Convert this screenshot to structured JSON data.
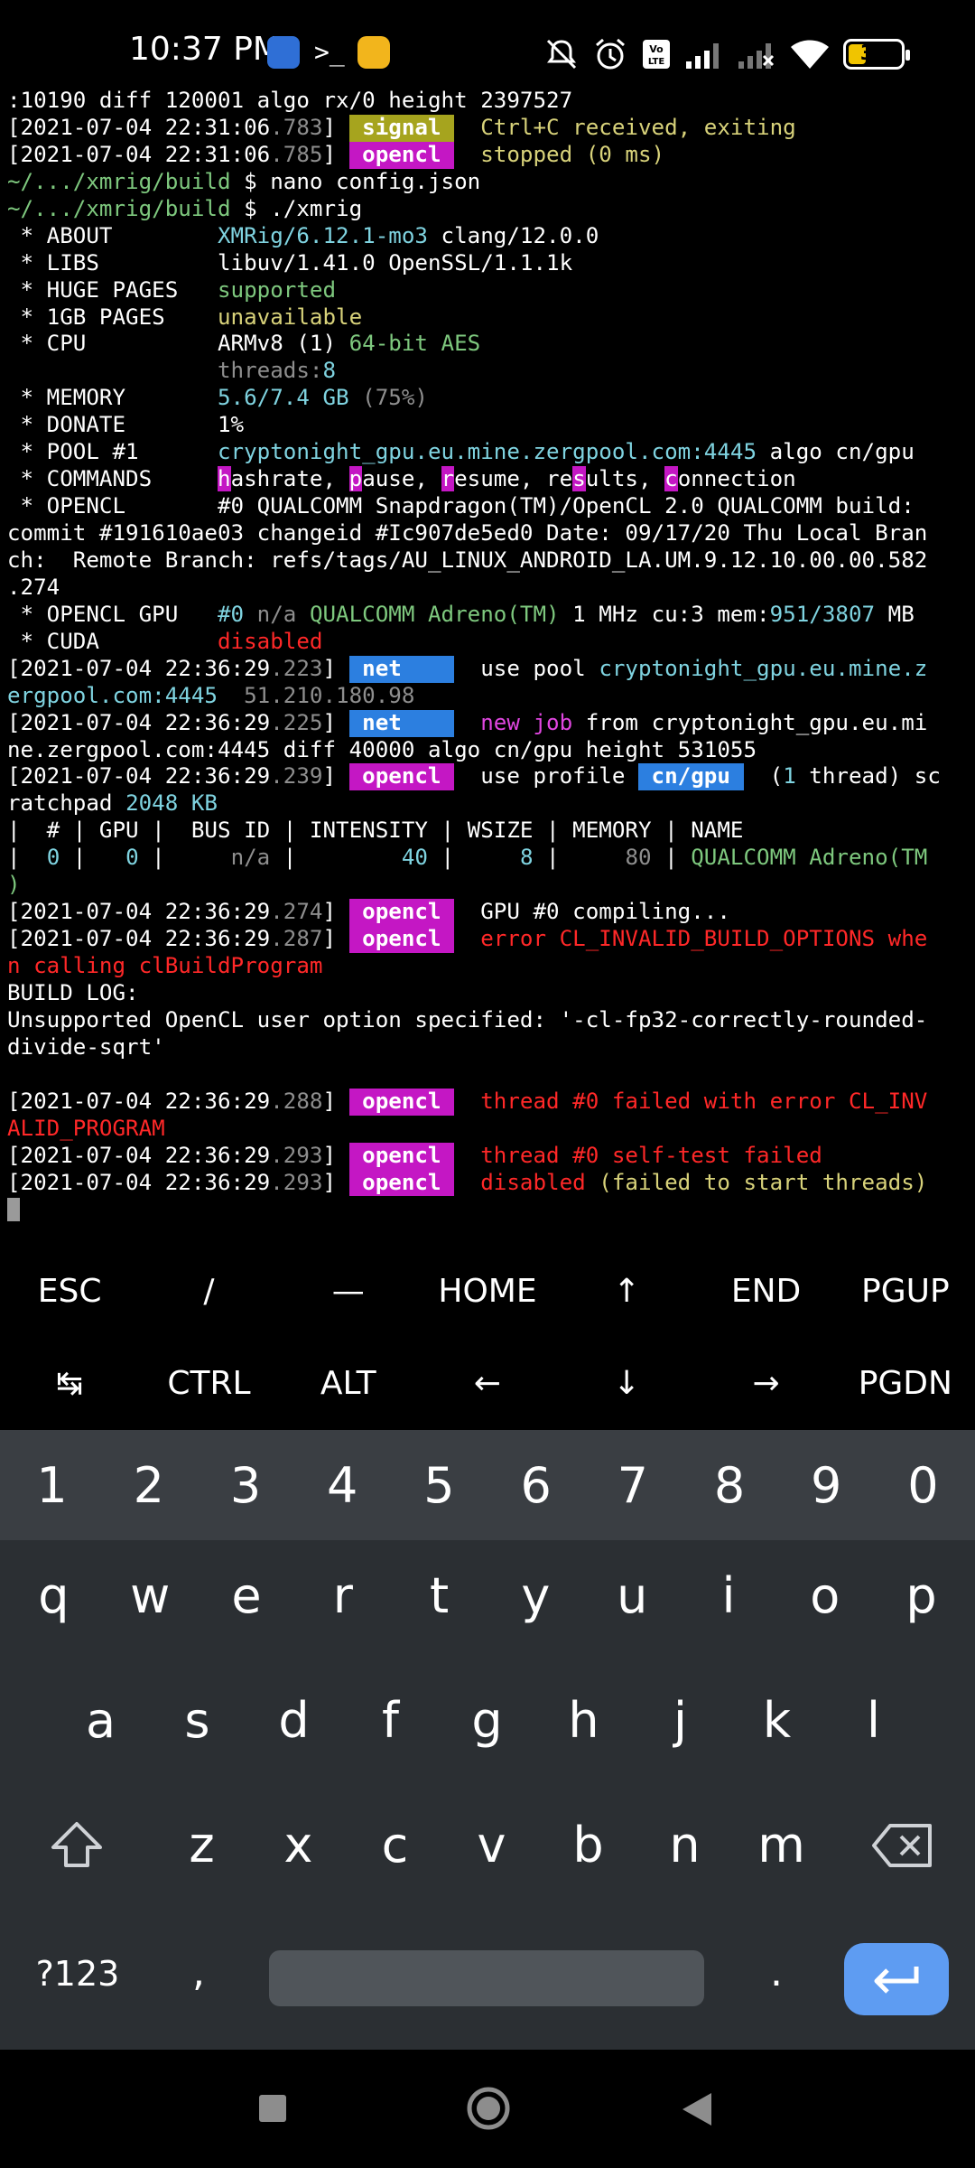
{
  "status_bar": {
    "time": "10:37 PM",
    "battery": "31",
    "icons": [
      "mute-icon",
      "alarm-icon",
      "volte-icon",
      "signal-icon",
      "signal-off-icon",
      "wifi-icon",
      "battery-icon"
    ]
  },
  "terminal": {
    "lines": [
      [
        {
          "t": ":10190 diff 120001 algo rx/0 height 2397527",
          "c": "w"
        }
      ],
      [
        {
          "t": "[2021-07-04 22:31:06",
          "c": "w"
        },
        {
          "t": ".783",
          "c": "gr"
        },
        {
          "t": "] ",
          "c": "w"
        },
        {
          "t": " signal ",
          "c": "tag tag-signal"
        },
        {
          "t": "  ",
          "c": "w"
        },
        {
          "t": "Ctrl+C received, exiting",
          "c": "y"
        }
      ],
      [
        {
          "t": "[2021-07-04 22:31:06",
          "c": "w"
        },
        {
          "t": ".785",
          "c": "gr"
        },
        {
          "t": "] ",
          "c": "w"
        },
        {
          "t": " opencl ",
          "c": "tag tag-opencl"
        },
        {
          "t": "  ",
          "c": "w"
        },
        {
          "t": "stopped (0 ms)",
          "c": "y"
        }
      ],
      [
        {
          "t": "~/.../xmrig/build",
          "c": "g"
        },
        {
          "t": " $ nano config.json",
          "c": "w"
        }
      ],
      [
        {
          "t": "~/.../xmrig/build",
          "c": "g"
        },
        {
          "t": " $ ./xmrig",
          "c": "w"
        }
      ],
      [
        {
          "t": " * ABOUT        ",
          "c": "w"
        },
        {
          "t": "XMRig/6.12.1-mo3",
          "c": "cy"
        },
        {
          "t": " clang/12.0.0",
          "c": "w"
        }
      ],
      [
        {
          "t": " * LIBS         ",
          "c": "w"
        },
        {
          "t": "libuv/1.41.0 OpenSSL/1.1.1k",
          "c": "w"
        }
      ],
      [
        {
          "t": " * HUGE PAGES   ",
          "c": "w"
        },
        {
          "t": "supported",
          "c": "g"
        }
      ],
      [
        {
          "t": " * 1GB PAGES    ",
          "c": "w"
        },
        {
          "t": "unavailable",
          "c": "y"
        }
      ],
      [
        {
          "t": " * CPU          ",
          "c": "w"
        },
        {
          "t": "ARMv8 (1) ",
          "c": "w"
        },
        {
          "t": "64-bit AES",
          "c": "g"
        }
      ],
      [
        {
          "t": "                ",
          "c": "w"
        },
        {
          "t": "threads:",
          "c": "gr"
        },
        {
          "t": "8",
          "c": "cy"
        }
      ],
      [
        {
          "t": " * MEMORY       ",
          "c": "w"
        },
        {
          "t": "5.6/7.4",
          "c": "cy"
        },
        {
          "t": " GB",
          "c": "cy"
        },
        {
          "t": " (75%)",
          "c": "gr"
        }
      ],
      [
        {
          "t": " * DONATE       ",
          "c": "w"
        },
        {
          "t": "1%",
          "c": "w"
        }
      ],
      [
        {
          "t": " * POOL #1      ",
          "c": "w"
        },
        {
          "t": "cryptonight_gpu.eu.mine.zergpool.com:4445",
          "c": "cy"
        },
        {
          "t": " algo ",
          "c": "w"
        },
        {
          "t": "cn/gpu",
          "c": "w"
        }
      ],
      [
        {
          "t": " * COMMANDS     ",
          "c": "w"
        },
        {
          "t": "h",
          "c": "hk"
        },
        {
          "t": "ashrate, ",
          "c": "w"
        },
        {
          "t": "p",
          "c": "hk"
        },
        {
          "t": "ause, ",
          "c": "w"
        },
        {
          "t": "r",
          "c": "hk"
        },
        {
          "t": "esume, re",
          "c": "w"
        },
        {
          "t": "s",
          "c": "hk"
        },
        {
          "t": "ults, ",
          "c": "w"
        },
        {
          "t": "c",
          "c": "hk"
        },
        {
          "t": "onnection",
          "c": "w"
        }
      ],
      [
        {
          "t": " * OPENCL       ",
          "c": "w"
        },
        {
          "t": "#0 QUALCOMM Snapdragon(TM)/OpenCL 2.0 QUALCOMM build:",
          "c": "w"
        }
      ],
      [
        {
          "t": "commit #191610ae03 changeid #Ic907de5ed0 Date: 09/17/20 Thu Local Bran",
          "c": "w"
        }
      ],
      [
        {
          "t": "ch:  Remote Branch: refs/tags/AU_LINUX_ANDROID_LA.UM.9.12.10.00.00.582",
          "c": "w"
        }
      ],
      [
        {
          "t": ".274",
          "c": "w"
        }
      ],
      [
        {
          "t": " * OPENCL GPU   ",
          "c": "w"
        },
        {
          "t": "#0",
          "c": "cy"
        },
        {
          "t": " n/a ",
          "c": "gr"
        },
        {
          "t": "QUALCOMM Adreno(TM)",
          "c": "g"
        },
        {
          "t": " 1 MHz ",
          "c": "w"
        },
        {
          "t": "cu:",
          "c": "w"
        },
        {
          "t": "3",
          "c": "w"
        },
        {
          "t": " mem:",
          "c": "w"
        },
        {
          "t": "951/3807",
          "c": "cy"
        },
        {
          "t": " MB",
          "c": "w"
        }
      ],
      [
        {
          "t": " * CUDA         ",
          "c": "w"
        },
        {
          "t": "disabled",
          "c": "r"
        }
      ],
      [
        {
          "t": "[2021-07-04 22:36:29",
          "c": "w"
        },
        {
          "t": ".223",
          "c": "gr"
        },
        {
          "t": "] ",
          "c": "w"
        },
        {
          "t": " net    ",
          "c": "tag tag-net"
        },
        {
          "t": "  use pool ",
          "c": "w"
        },
        {
          "t": "cryptonight_gpu.eu.mine.z",
          "c": "cy"
        }
      ],
      [
        {
          "t": "ergpool.com:4445",
          "c": "cy"
        },
        {
          "t": "  51.210.180.98",
          "c": "gr"
        }
      ],
      [
        {
          "t": "[2021-07-04 22:36:29",
          "c": "w"
        },
        {
          "t": ".225",
          "c": "gr"
        },
        {
          "t": "] ",
          "c": "w"
        },
        {
          "t": " net    ",
          "c": "tag tag-net"
        },
        {
          "t": "  ",
          "c": "w"
        },
        {
          "t": "new job",
          "c": "m"
        },
        {
          "t": " from ",
          "c": "w"
        },
        {
          "t": "cryptonight_gpu.eu.mi",
          "c": "w"
        }
      ],
      [
        {
          "t": "ne.zergpool.com:4445 diff 40000 algo cn/gpu height 531055",
          "c": "w"
        }
      ],
      [
        {
          "t": "[2021-07-04 22:36:29",
          "c": "w"
        },
        {
          "t": ".239",
          "c": "gr"
        },
        {
          "t": "] ",
          "c": "w"
        },
        {
          "t": " opencl ",
          "c": "tag tag-opencl"
        },
        {
          "t": "  use profile ",
          "c": "w"
        },
        {
          "t": " cn/gpu ",
          "c": "tag tag-cn"
        },
        {
          "t": "  (",
          "c": "w"
        },
        {
          "t": "1",
          "c": "cy"
        },
        {
          "t": " thread) sc",
          "c": "w"
        }
      ],
      [
        {
          "t": "ratchpad ",
          "c": "w"
        },
        {
          "t": "2048 KB",
          "c": "cy"
        }
      ],
      [
        {
          "t": "|  # | GPU |  BUS ID | INTENSITY | WSIZE | MEMORY | NAME",
          "c": "w"
        }
      ],
      [
        {
          "t": "|  ",
          "c": "w"
        },
        {
          "t": "0",
          "c": "cy"
        },
        {
          "t": " |   ",
          "c": "w"
        },
        {
          "t": "0",
          "c": "cy"
        },
        {
          "t": " |     ",
          "c": "w"
        },
        {
          "t": "n/a",
          "c": "gr"
        },
        {
          "t": " |        ",
          "c": "w"
        },
        {
          "t": "40",
          "c": "cy"
        },
        {
          "t": " |     ",
          "c": "w"
        },
        {
          "t": "8",
          "c": "cy"
        },
        {
          "t": " |     ",
          "c": "w"
        },
        {
          "t": "80",
          "c": "gr"
        },
        {
          "t": " | ",
          "c": "w"
        },
        {
          "t": "QUALCOMM Adreno(TM",
          "c": "g"
        }
      ],
      [
        {
          "t": ")",
          "c": "g"
        }
      ],
      [
        {
          "t": "[2021-07-04 22:36:29",
          "c": "w"
        },
        {
          "t": ".274",
          "c": "gr"
        },
        {
          "t": "] ",
          "c": "w"
        },
        {
          "t": " opencl ",
          "c": "tag tag-opencl"
        },
        {
          "t": "  GPU #0 compiling...",
          "c": "w"
        }
      ],
      [
        {
          "t": "[2021-07-04 22:36:29",
          "c": "w"
        },
        {
          "t": ".287",
          "c": "gr"
        },
        {
          "t": "] ",
          "c": "w"
        },
        {
          "t": " opencl ",
          "c": "tag tag-opencl"
        },
        {
          "t": "  error ",
          "c": "r"
        },
        {
          "t": "CL_INVALID_BUILD_OPTIONS",
          "c": "r"
        },
        {
          "t": " whe",
          "c": "r"
        }
      ],
      [
        {
          "t": "n calling ",
          "c": "r"
        },
        {
          "t": "clBuildProgram",
          "c": "r"
        }
      ],
      [
        {
          "t": "BUILD LOG:",
          "c": "w"
        }
      ],
      [
        {
          "t": "Unsupported OpenCL user option specified: '-cl-fp32-correctly-rounded-",
          "c": "w"
        }
      ],
      [
        {
          "t": "divide-sqrt'",
          "c": "w"
        }
      ],
      [
        {
          "t": "",
          "c": "w"
        }
      ],
      [
        {
          "t": "[2021-07-04 22:36:29",
          "c": "w"
        },
        {
          "t": ".288",
          "c": "gr"
        },
        {
          "t": "] ",
          "c": "w"
        },
        {
          "t": " opencl ",
          "c": "tag tag-opencl"
        },
        {
          "t": "  thread #0 failed with error ",
          "c": "r"
        },
        {
          "t": "CL_INV",
          "c": "r"
        }
      ],
      [
        {
          "t": "ALID_PROGRAM",
          "c": "r"
        }
      ],
      [
        {
          "t": "[2021-07-04 22:36:29",
          "c": "w"
        },
        {
          "t": ".293",
          "c": "gr"
        },
        {
          "t": "] ",
          "c": "w"
        },
        {
          "t": " opencl ",
          "c": "tag tag-opencl"
        },
        {
          "t": "  thread #0 self-test failed",
          "c": "r"
        }
      ],
      [
        {
          "t": "[2021-07-04 22:36:29",
          "c": "w"
        },
        {
          "t": ".293",
          "c": "gr"
        },
        {
          "t": "] ",
          "c": "w"
        },
        {
          "t": " opencl ",
          "c": "tag tag-opencl"
        },
        {
          "t": "  disabled",
          "c": "r"
        },
        {
          "t": " (failed to start threads)",
          "c": "y"
        }
      ]
    ]
  },
  "extra_keys": {
    "row1": [
      "ESC",
      "/",
      "—",
      "HOME",
      "↑",
      "END",
      "PGUP"
    ],
    "row2": [
      "↹",
      "CTRL",
      "ALT",
      "←",
      "↓",
      "→",
      "PGDN"
    ]
  },
  "keyboard": {
    "numbers": [
      "1",
      "2",
      "3",
      "4",
      "5",
      "6",
      "7",
      "8",
      "9",
      "0"
    ],
    "row1": [
      "q",
      "w",
      "e",
      "r",
      "t",
      "y",
      "u",
      "i",
      "o",
      "p"
    ],
    "row2": [
      "a",
      "s",
      "d",
      "f",
      "g",
      "h",
      "j",
      "k",
      "l"
    ],
    "row3": [
      "z",
      "x",
      "c",
      "v",
      "b",
      "n",
      "m"
    ],
    "symbols_label": "?123",
    "comma": ",",
    "period": "."
  }
}
